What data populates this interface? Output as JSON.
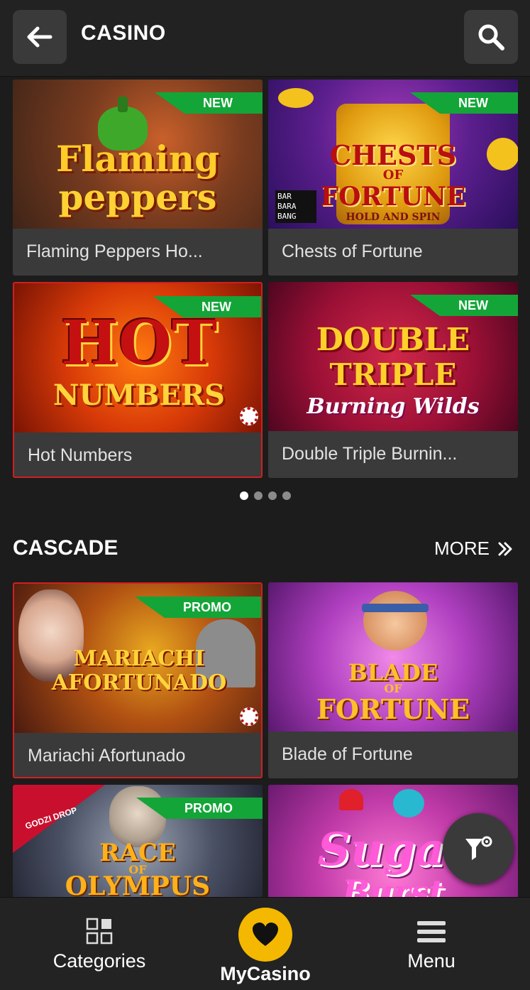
{
  "header": {
    "back_icon": "arrow-left-icon",
    "title": "CASINO",
    "search_icon": "magnifier-icon"
  },
  "top_games": [
    {
      "name": "Flaming Peppers Ho...",
      "badge": "NEW",
      "thumb_text_line1": "Flaming",
      "thumb_text_line2": "peppers"
    },
    {
      "name": "Chests of Fortune",
      "badge": "NEW",
      "thumb_text_line1": "CHESTS",
      "thumb_text_line2": "OF",
      "thumb_text_line3": "FORTUNE",
      "thumb_text_line4": "HOLD AND SPIN",
      "provider_logo": "BAR BARA BANG"
    },
    {
      "name": "Hot Numbers",
      "badge": "NEW",
      "thumb_text_line1": "HOT",
      "thumb_text_line2": "NUMBERS"
    },
    {
      "name": "Double Triple Burnin...",
      "badge": "NEW",
      "thumb_text_line1": "DOUBLE",
      "thumb_text_line2": "TRIPLE",
      "thumb_text_line3": "Burning Wilds"
    }
  ],
  "carousel": {
    "pages": 4,
    "active": 1
  },
  "cascade": {
    "title": "CASCADE",
    "more_label": "MORE",
    "games": [
      {
        "name": "Mariachi Afortunado",
        "badge": "PROMO",
        "thumb_text_line1": "MARIACHI",
        "thumb_text_line2": "AFORTUNADO"
      },
      {
        "name": "Blade of Fortune",
        "badge": "",
        "thumb_text_line1": "BLADE",
        "thumb_text_line2": "OF",
        "thumb_text_line3": "FORTUNE"
      },
      {
        "name": "",
        "badge": "PROMO",
        "thumb_text_line1": "RACE",
        "thumb_text_line2": "OF",
        "thumb_text_line3": "OLYMPUS",
        "corner_label": "GODZI DROP"
      },
      {
        "name": "",
        "badge": "",
        "thumb_text_line1": "Sugar",
        "thumb_text_line2": "Burst"
      }
    ]
  },
  "filter_fab_icon": "filter-gear-icon",
  "bottom_nav": {
    "categories_label": "Categories",
    "mycasino_label": "MyCasino",
    "menu_label": "Menu"
  },
  "colors": {
    "background": "#1c1c1c",
    "card": "#3a3a3a",
    "badge_green": "#13a538",
    "accent_yellow": "#f5b800"
  }
}
